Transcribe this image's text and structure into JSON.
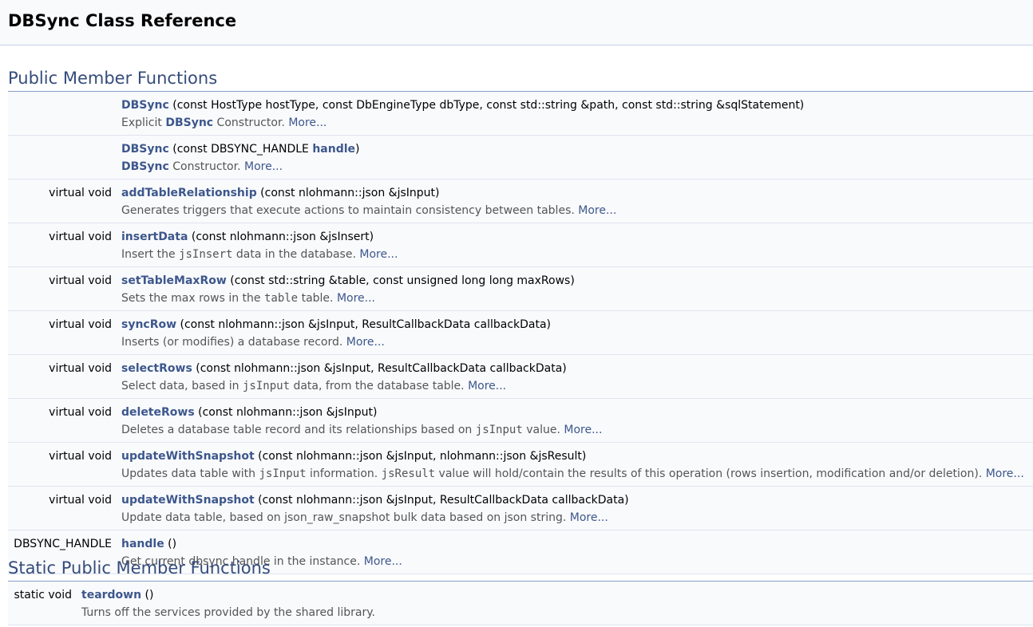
{
  "page": {
    "title": "DBSync Class Reference"
  },
  "sections": [
    {
      "heading": "Public Member Functions",
      "members": [
        {
          "type": "",
          "name": "DBSync",
          "signature": " (const HostType hostType, const DbEngineType dbType, const std::string &path, const std::string &sqlStatement)",
          "desc": [
            {
              "t": "text",
              "v": "Explicit "
            },
            {
              "t": "ref",
              "v": "DBSync"
            },
            {
              "t": "text",
              "v": " Constructor. "
            }
          ],
          "more": "More..."
        },
        {
          "type": "",
          "name": "DBSync",
          "signature_parts": [
            {
              "t": "text",
              "v": " (const DBSYNC_HANDLE "
            },
            {
              "t": "ref",
              "v": "handle"
            },
            {
              "t": "text",
              "v": ")"
            }
          ],
          "desc": [
            {
              "t": "ref",
              "v": "DBSync"
            },
            {
              "t": "text",
              "v": " Constructor. "
            }
          ],
          "more": "More..."
        },
        {
          "type": "virtual void",
          "name": "addTableRelationship",
          "signature": " (const nlohmann::json &jsInput)",
          "desc": [
            {
              "t": "text",
              "v": "Generates triggers that execute actions to maintain consistency between tables. "
            }
          ],
          "more": "More..."
        },
        {
          "type": "virtual void",
          "name": "insertData",
          "signature": " (const nlohmann::json &jsInsert)",
          "desc": [
            {
              "t": "text",
              "v": "Insert the "
            },
            {
              "t": "code",
              "v": "jsInsert"
            },
            {
              "t": "text",
              "v": " data in the database. "
            }
          ],
          "more": "More..."
        },
        {
          "type": "virtual void",
          "name": "setTableMaxRow",
          "signature": " (const std::string &table, const unsigned long long maxRows)",
          "desc": [
            {
              "t": "text",
              "v": "Sets the max rows in the "
            },
            {
              "t": "code",
              "v": "table"
            },
            {
              "t": "text",
              "v": " table. "
            }
          ],
          "more": "More..."
        },
        {
          "type": "virtual void",
          "name": "syncRow",
          "signature": " (const nlohmann::json &jsInput, ResultCallbackData callbackData)",
          "desc": [
            {
              "t": "text",
              "v": "Inserts (or modifies) a database record. "
            }
          ],
          "more": "More..."
        },
        {
          "type": "virtual void",
          "name": "selectRows",
          "signature": " (const nlohmann::json &jsInput, ResultCallbackData callbackData)",
          "desc": [
            {
              "t": "text",
              "v": "Select data, based in "
            },
            {
              "t": "code",
              "v": "jsInput"
            },
            {
              "t": "text",
              "v": " data, from the database table. "
            }
          ],
          "more": "More..."
        },
        {
          "type": "virtual void",
          "name": "deleteRows",
          "signature": " (const nlohmann::json &jsInput)",
          "desc": [
            {
              "t": "text",
              "v": "Deletes a database table record and its relationships based on "
            },
            {
              "t": "code",
              "v": "jsInput"
            },
            {
              "t": "text",
              "v": " value. "
            }
          ],
          "more": "More..."
        },
        {
          "type": "virtual void",
          "name": "updateWithSnapshot",
          "signature": " (const nlohmann::json &jsInput, nlohmann::json &jsResult)",
          "desc": [
            {
              "t": "text",
              "v": "Updates data table with "
            },
            {
              "t": "code",
              "v": "jsInput"
            },
            {
              "t": "text",
              "v": " information. "
            },
            {
              "t": "code",
              "v": "jsResult"
            },
            {
              "t": "text",
              "v": " value will hold/contain the results of this operation (rows insertion, modification and/or deletion). "
            }
          ],
          "more": "More..."
        },
        {
          "type": "virtual void",
          "name": "updateWithSnapshot",
          "signature": " (const nlohmann::json &jsInput, ResultCallbackData callbackData)",
          "desc": [
            {
              "t": "text",
              "v": "Update data table, based on json_raw_snapshot bulk data based on json string. "
            }
          ],
          "more": "More..."
        },
        {
          "type": "DBSYNC_HANDLE",
          "name": "handle",
          "signature": " ()",
          "desc": [
            {
              "t": "text",
              "v": "Get current dbsync handle in the instance. "
            }
          ],
          "more": "More..."
        }
      ]
    },
    {
      "heading": "Static Public Member Functions",
      "members": [
        {
          "type": "static void",
          "name": "teardown",
          "signature": " ()",
          "desc": [
            {
              "t": "text",
              "v": "Turns off the services provided by the shared library."
            }
          ],
          "more": ""
        }
      ]
    }
  ]
}
